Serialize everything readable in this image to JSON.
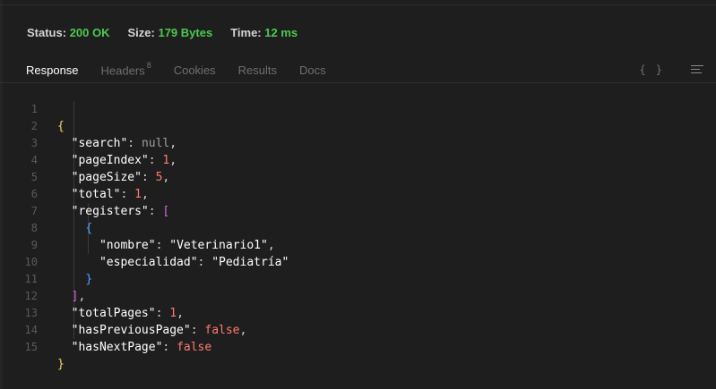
{
  "status": {
    "status_label": "Status:",
    "status_value": "200 OK",
    "size_label": "Size:",
    "size_value": "179 Bytes",
    "time_label": "Time:",
    "time_value": "12 ms"
  },
  "tabs": [
    {
      "label": "Response",
      "active": true
    },
    {
      "label": "Headers",
      "badge": "8"
    },
    {
      "label": "Cookies"
    },
    {
      "label": "Results"
    },
    {
      "label": "Docs"
    }
  ],
  "toolbar": {
    "format_glyph": "{ }"
  },
  "colors": {
    "status_green": "#4ec94e",
    "number_red": "#ff7b72",
    "bracket_yellow": "#f7d36a",
    "bracket_blue": "#4fa3ff",
    "bracket_purple": "#d16bd8"
  },
  "json_lines": [
    {
      "n": "1"
    },
    {
      "n": "2",
      "key": "\"search\"",
      "value": "null"
    },
    {
      "n": "3",
      "key": "\"pageIndex\"",
      "value": "1"
    },
    {
      "n": "4",
      "key": "\"pageSize\"",
      "value": "5"
    },
    {
      "n": "5",
      "key": "\"total\"",
      "value": "1"
    },
    {
      "n": "6",
      "key": "\"registers\""
    },
    {
      "n": "7"
    },
    {
      "n": "8",
      "key": "\"nombre\"",
      "value": "\"Veterinario1\""
    },
    {
      "n": "9",
      "key": "\"especialidad\"",
      "value": "\"Pediatría\""
    },
    {
      "n": "10"
    },
    {
      "n": "11"
    },
    {
      "n": "12",
      "key": "\"totalPages\"",
      "value": "1"
    },
    {
      "n": "13",
      "key": "\"hasPreviousPage\"",
      "value": "false"
    },
    {
      "n": "14",
      "key": "\"hasNextPage\"",
      "value": "false"
    },
    {
      "n": "15"
    }
  ]
}
